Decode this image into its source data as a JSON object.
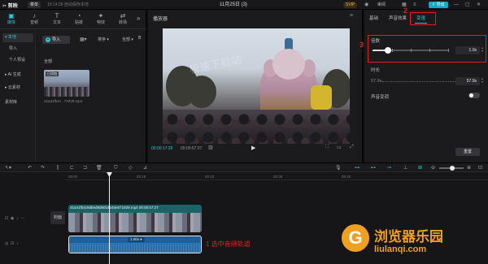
{
  "titlebar": {
    "app_name": "剪映",
    "menu": "菜单",
    "autosave": "10:14:28 自动保存本地",
    "doc_title": "11月25日 (3)",
    "vip": "SVIP",
    "share": "审阅",
    "export": "导出"
  },
  "media_tabs": [
    {
      "icon": "▣",
      "label": "媒体"
    },
    {
      "icon": "♪",
      "label": "音频"
    },
    {
      "icon": "T",
      "label": "文本"
    },
    {
      "icon": "◔",
      "label": "贴纸"
    },
    {
      "icon": "✦",
      "label": "特效"
    },
    {
      "icon": "⇄",
      "label": "转场"
    }
  ],
  "side_list": [
    "本地",
    "导入",
    "个人预设",
    "AI 生成",
    "云素材",
    "素材库"
  ],
  "media": {
    "import_label": "导入",
    "sort_label": "排序",
    "all_filter": "全部",
    "all_label": "全部",
    "thumb_badge": "已添加",
    "thumb_name": "41a41fb4c...71929.mp4"
  },
  "player": {
    "title": "播放器",
    "watermark": "极速下载站",
    "time_current": "00:00:17:29",
    "time_total": "00:00:57:27"
  },
  "props": {
    "tabs": [
      "基础",
      "声音效果",
      "变速"
    ],
    "active_tab": "变速",
    "annot_2": "2",
    "annot_3": "3",
    "speed_label": "倍数",
    "speed_value": "1.0x",
    "speed_fraction": 0.2,
    "duration_label": "时长",
    "duration_from": "57.9s",
    "duration_to": "57.9s",
    "pitch_label": "声音变调",
    "reset": "重置"
  },
  "ruler_ticks": [
    "00:00",
    "00:10",
    "00:20",
    "00:30",
    "00:40"
  ],
  "timeline": {
    "cover": "封面",
    "video_clip_name": "41a41fb4c9dbed9d6016b45e071929.mp4    00:00:57:27",
    "audio_speed": "1.00x ♦",
    "annot_1": "1 选中音频轨道"
  },
  "brand": {
    "cn": "浏览器乐园",
    "url": "liulanqi.com"
  },
  "colors": {
    "accent": "#32c8d8",
    "annotation_red": "#e02020",
    "brand_orange": "#f0a020"
  }
}
